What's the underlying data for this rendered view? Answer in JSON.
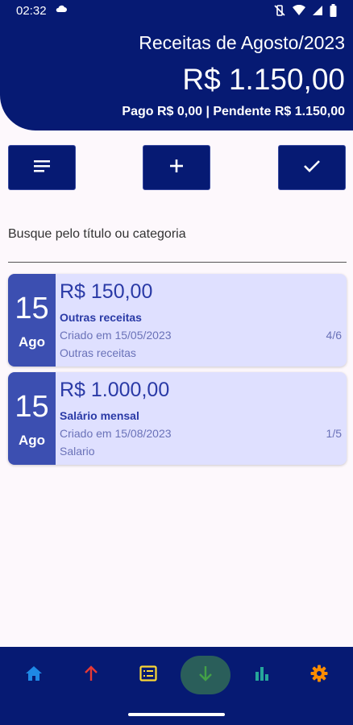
{
  "status_bar": {
    "time": "02:32"
  },
  "header": {
    "title": "Receitas de Agosto/2023",
    "total": "R$ 1.150,00",
    "summary": "Pago R$ 0,00 | Pendente R$ 1.150,00"
  },
  "actions": {
    "filter_icon": "filter-lines-icon",
    "add_icon": "plus-icon",
    "check_icon": "check-icon"
  },
  "search": {
    "placeholder": "Busque pelo título ou categoria",
    "value": ""
  },
  "items": [
    {
      "day": "15",
      "month": "Ago",
      "amount": "R$ 150,00",
      "title": "Outras receitas",
      "created": "Criado em 15/05/2023",
      "installment": "4/6",
      "category": "Outras receitas"
    },
    {
      "day": "15",
      "month": "Ago",
      "amount": "R$ 1.000,00",
      "title": "Salário mensal",
      "created": "Criado em 15/08/2023",
      "installment": "1/5",
      "category": "Salario"
    }
  ],
  "nav": {
    "items": [
      {
        "icon": "home-icon",
        "color": "#1e88e5"
      },
      {
        "icon": "arrow-up-icon",
        "color": "#e53935"
      },
      {
        "icon": "list-icon",
        "color": "#fdd835"
      },
      {
        "icon": "arrow-down-icon",
        "color": "#43a047",
        "selected": true
      },
      {
        "icon": "bar-chart-icon",
        "color": "#26a69a"
      },
      {
        "icon": "gear-icon",
        "color": "#fb8c00"
      }
    ]
  },
  "colors": {
    "primary": "#061a73",
    "card_bg": "#dfe0ff",
    "date_bg": "#3c4fb1",
    "text_accent": "#2a3aa6"
  }
}
